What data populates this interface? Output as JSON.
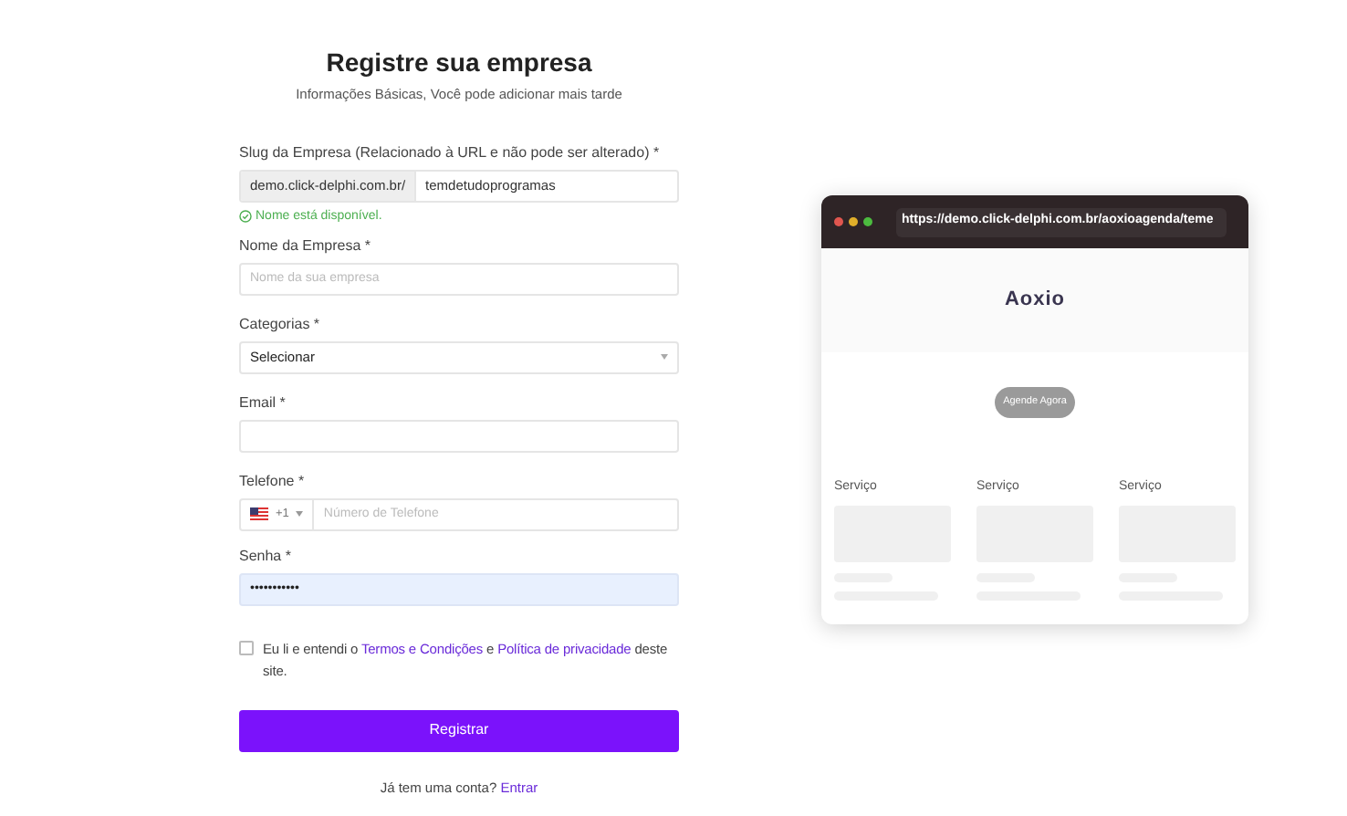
{
  "header": {
    "title": "Registre sua empresa",
    "subtitle": "Informações Básicas, Você pode adicionar mais tarde"
  },
  "slug": {
    "label": "Slug da Empresa (Relacionado à URL e não pode ser alterado) *",
    "prefix": "demo.click-delphi.com.br/",
    "value": "temdetudoprogramas",
    "status": "Nome está disponível.",
    "available": true
  },
  "company_name": {
    "label": "Nome da Empresa *",
    "placeholder": "Nome da sua empresa"
  },
  "categories": {
    "label": "Categorias *",
    "value": "Selecionar"
  },
  "email": {
    "label": "Email *"
  },
  "phone": {
    "label": "Telefone *",
    "dial_code": "+1",
    "placeholder": "Número de Telefone"
  },
  "password": {
    "label": "Senha *",
    "value": "•••••••••••"
  },
  "terms": {
    "checked": false,
    "text_before": "Eu li e entendi o",
    "terms_link": "Termos e Condições",
    "middle": "e",
    "privacy_link": "Política de privacidade",
    "text_after": "deste site."
  },
  "submit": {
    "label": "Registrar"
  },
  "footer": {
    "text": "Já tem uma conta?",
    "link": "Entrar"
  },
  "preview": {
    "url": "https://demo.click-delphi.com.br/aoxioagenda/teme",
    "logo": "Aoxio",
    "cta": "Agende Agora",
    "services": [
      {
        "label": "Serviço"
      },
      {
        "label": "Serviço"
      },
      {
        "label": "Serviço"
      }
    ]
  }
}
